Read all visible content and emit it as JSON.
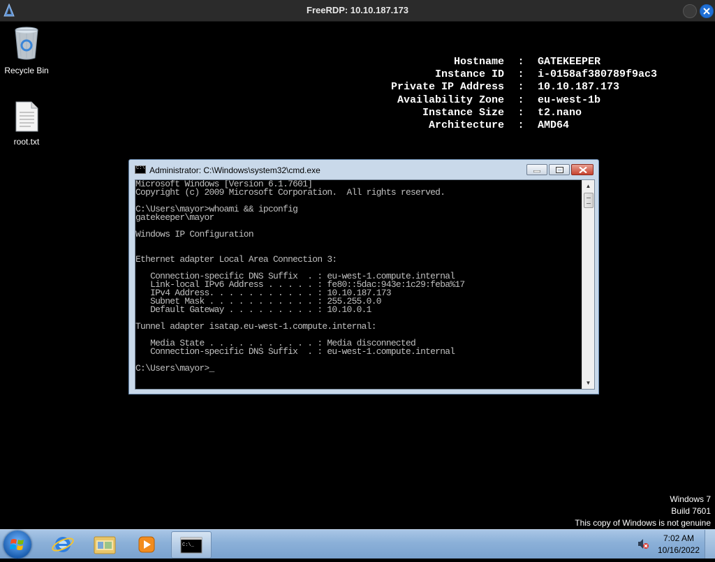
{
  "rdp": {
    "title": "FreeRDP: 10.10.187.173"
  },
  "desktop": {
    "icons": [
      {
        "label": "Recycle Bin",
        "icon": "recycle-bin-icon"
      },
      {
        "label": "root.txt",
        "icon": "text-file-icon"
      }
    ]
  },
  "bginfo": {
    "rows": [
      {
        "key": "Hostname",
        "sep": ":",
        "value": "GATEKEEPER"
      },
      {
        "key": "Instance ID",
        "sep": ":",
        "value": "i-0158af380789f9ac3"
      },
      {
        "key": "Private IP Address",
        "sep": ":",
        "value": "10.10.187.173"
      },
      {
        "key": "Availability Zone",
        "sep": ":",
        "value": "eu-west-1b"
      },
      {
        "key": "Instance Size",
        "sep": ":",
        "value": "t2.nano"
      },
      {
        "key": "Architecture",
        "sep": ":",
        "value": "AMD64"
      }
    ]
  },
  "cmd": {
    "title": "Administrator: C:\\Windows\\system32\\cmd.exe",
    "lines": [
      "Microsoft Windows [Version 6.1.7601]",
      "Copyright (c) 2009 Microsoft Corporation.  All rights reserved.",
      "",
      "C:\\Users\\mayor>whoami && ipconfig",
      "gatekeeper\\mayor",
      "",
      "Windows IP Configuration",
      "",
      "",
      "Ethernet adapter Local Area Connection 3:",
      "",
      "   Connection-specific DNS Suffix  . : eu-west-1.compute.internal",
      "   Link-local IPv6 Address . . . . . : fe80::5dac:943e:1c29:feba%17",
      "   IPv4 Address. . . . . . . . . . . : 10.10.187.173",
      "   Subnet Mask . . . . . . . . . . . : 255.255.0.0",
      "   Default Gateway . . . . . . . . . : 10.10.0.1",
      "",
      "Tunnel adapter isatap.eu-west-1.compute.internal:",
      "",
      "   Media State . . . . . . . . . . . : Media disconnected",
      "   Connection-specific DNS Suffix  . : eu-west-1.compute.internal",
      ""
    ],
    "prompt": "C:\\Users\\mayor>",
    "cursor": "_"
  },
  "watermark": {
    "line1": "Windows 7",
    "line2": "Build 7601",
    "line3": "This copy of Windows is not genuine"
  },
  "taskbar": {
    "items": [
      "start-orb",
      "internet-explorer",
      "windows-explorer",
      "media-player",
      "command-prompt"
    ],
    "time": "7:02 AM",
    "date": "10/16/2022"
  },
  "colors": {
    "desktop_bg": "#000000",
    "taskbar": "#8bb0d8",
    "console_bg": "#000000",
    "console_fg": "#c0c0c0",
    "close_button": "#c7432f"
  }
}
